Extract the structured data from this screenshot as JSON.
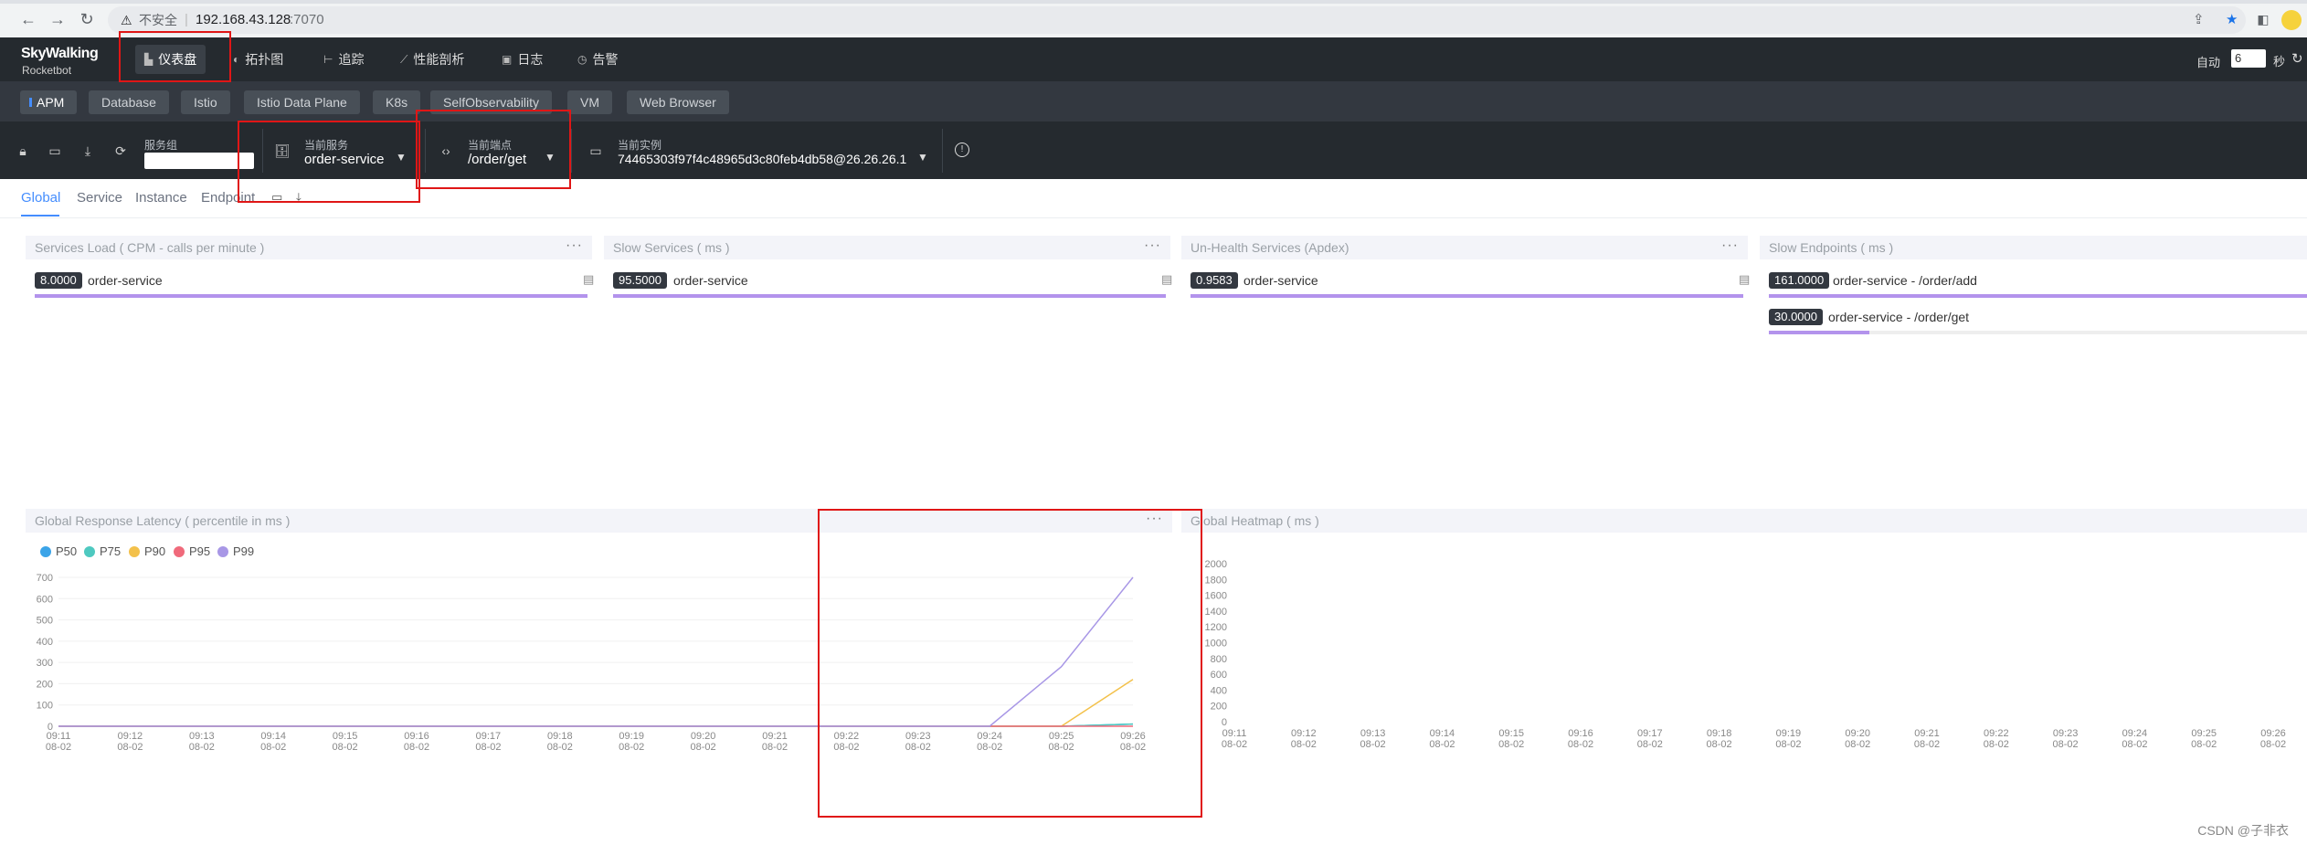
{
  "browser": {
    "security_text": "不安全",
    "url_host": "192.168.43.128",
    "url_port": ":7070"
  },
  "header": {
    "logo_top": "SkyWalking",
    "logo_bottom": "Rocketbot",
    "nav": [
      {
        "label": "仪表盘",
        "icon": "dashboard-icon"
      },
      {
        "label": "拓扑图",
        "icon": "topology-icon"
      },
      {
        "label": "追踪",
        "icon": "trace-icon"
      },
      {
        "label": "性能剖析",
        "icon": "profile-icon"
      },
      {
        "label": "日志",
        "icon": "log-icon"
      },
      {
        "label": "告警",
        "icon": "alarm-icon"
      }
    ],
    "auto_label": "自动",
    "auto_value": "6",
    "seconds_label": "秒"
  },
  "layers": [
    "APM",
    "Database",
    "Istio",
    "Istio Data Plane",
    "K8s",
    "SelfObservability",
    "VM",
    "Web Browser"
  ],
  "selectors": {
    "group_label": "服务组",
    "group_value": "",
    "service_label": "当前服务",
    "service_value": "order-service",
    "endpoint_label": "当前端点",
    "endpoint_value": "/order/get",
    "instance_label": "当前实例",
    "instance_value": "74465303f97f4c48965d3c80feb4db58@26.26.26.1"
  },
  "subtabs": [
    "Global",
    "Service",
    "Instance",
    "Endpoint"
  ],
  "panels": {
    "services_load": {
      "title": "Services Load ( CPM - calls per minute )",
      "rows": [
        {
          "value": "8.0000",
          "name": "order-service",
          "fraction": 1.0
        }
      ]
    },
    "slow_services": {
      "title": "Slow Services ( ms )",
      "rows": [
        {
          "value": "95.5000",
          "name": "order-service",
          "fraction": 1.0
        }
      ]
    },
    "unhealth_services": {
      "title": "Un-Health Services (Apdex)",
      "rows": [
        {
          "value": "0.9583",
          "name": "order-service",
          "fraction": 1.0
        }
      ]
    },
    "slow_endpoints": {
      "title": "Slow Endpoints ( ms )",
      "rows": [
        {
          "value": "161.0000",
          "name": "order-service - /order/add",
          "fraction": 1.0
        },
        {
          "value": "30.0000",
          "name": "order-service - /order/get",
          "fraction": 0.186
        }
      ]
    },
    "latency": {
      "title": "Global Response Latency ( percentile in ms )"
    },
    "heatmap": {
      "title": "Global Heatmap ( ms )"
    }
  },
  "colors": {
    "P50": "#3ba4e8",
    "P75": "#4ec9c0",
    "P90": "#f3c14b",
    "P95": "#f06a7b",
    "P99": "#a897e6",
    "accent": "#448dfe",
    "highlight_box": "#e01616"
  },
  "chart_data": [
    {
      "type": "line",
      "title": "Global Response Latency ( percentile in ms )",
      "legend_position": "top-left",
      "x": [
        "09:11\n08-02",
        "09:12\n08-02",
        "09:13\n08-02",
        "09:14\n08-02",
        "09:15\n08-02",
        "09:16\n08-02",
        "09:17\n08-02",
        "09:18\n08-02",
        "09:19\n08-02",
        "09:20\n08-02",
        "09:21\n08-02",
        "09:22\n08-02",
        "09:23\n08-02",
        "09:24\n08-02",
        "09:25\n08-02",
        "09:26\n08-02"
      ],
      "y_ticks": [
        0,
        100,
        200,
        300,
        400,
        500,
        600,
        700
      ],
      "ylim": [
        0,
        700
      ],
      "grid": true,
      "series": [
        {
          "name": "P50",
          "values": [
            0,
            0,
            0,
            0,
            0,
            0,
            0,
            0,
            0,
            0,
            0,
            0,
            0,
            0,
            0,
            10
          ]
        },
        {
          "name": "P75",
          "values": [
            0,
            0,
            0,
            0,
            0,
            0,
            0,
            0,
            0,
            0,
            0,
            0,
            0,
            0,
            0,
            10
          ]
        },
        {
          "name": "P90",
          "values": [
            0,
            0,
            0,
            0,
            0,
            0,
            0,
            0,
            0,
            0,
            0,
            0,
            0,
            0,
            0,
            220
          ]
        },
        {
          "name": "P95",
          "values": [
            0,
            0,
            0,
            0,
            0,
            0,
            0,
            0,
            0,
            0,
            0,
            0,
            0,
            0,
            0,
            0
          ]
        },
        {
          "name": "P99",
          "values": [
            0,
            0,
            0,
            0,
            0,
            0,
            0,
            0,
            0,
            0,
            0,
            0,
            0,
            0,
            280,
            700
          ]
        }
      ]
    },
    {
      "type": "heatmap",
      "title": "Global Heatmap ( ms )",
      "x": [
        "09:11\n08-02",
        "09:12\n08-02",
        "09:13\n08-02",
        "09:14\n08-02",
        "09:15\n08-02",
        "09:16\n08-02",
        "09:17\n08-02",
        "09:18\n08-02",
        "09:19\n08-02",
        "09:20\n08-02",
        "09:21\n08-02",
        "09:22\n08-02",
        "09:23\n08-02",
        "09:24\n08-02",
        "09:25\n08-02",
        "09:26\n08-02"
      ],
      "y_ticks": [
        0,
        200,
        400,
        600,
        800,
        1000,
        1200,
        1400,
        1600,
        1800,
        2000
      ],
      "ylim": [
        0,
        2000
      ],
      "values": []
    }
  ],
  "footer": "CSDN @子非衣"
}
